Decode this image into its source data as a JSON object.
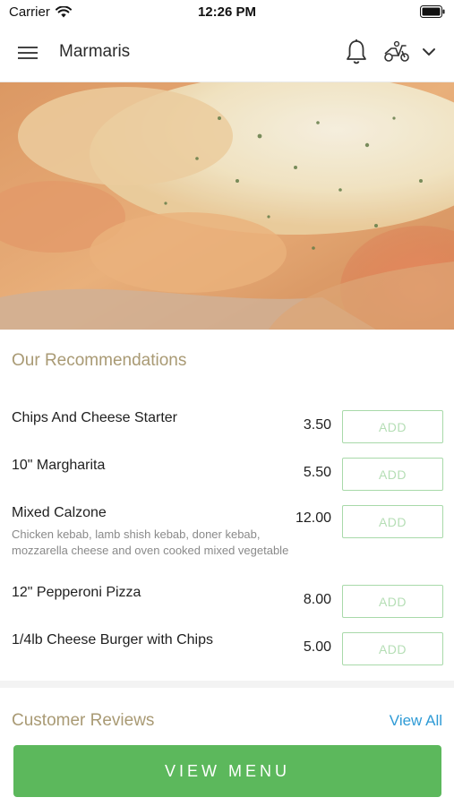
{
  "status_bar": {
    "carrier": "Carrier",
    "time": "12:26 PM"
  },
  "nav": {
    "title": "Marmaris",
    "icons": [
      "menu-icon",
      "bell-icon",
      "scooter-icon",
      "chevron-down-icon"
    ]
  },
  "recommendations": {
    "title": "Our Recommendations",
    "add_label": "ADD",
    "items": [
      {
        "name": "Chips And Cheese Starter",
        "price": "3.50",
        "description": ""
      },
      {
        "name": "10\" Margharita",
        "price": "5.50",
        "description": ""
      },
      {
        "name": "Mixed Calzone",
        "price": "12.00",
        "description": "Chicken kebab, lamb shish kebab, doner kebab, mozzarella cheese and oven cooked mixed vegetable"
      },
      {
        "name": "12\" Pepperoni Pizza",
        "price": "8.00",
        "description": ""
      },
      {
        "name": "1/4lb Cheese Burger with Chips",
        "price": "5.00",
        "description": ""
      }
    ]
  },
  "reviews": {
    "title": "Customer Reviews",
    "view_all": "View All"
  },
  "footer": {
    "view_menu": "VIEW MENU"
  },
  "colors": {
    "accent_green": "#5cb85c",
    "section_title": "#a99a74",
    "link_blue": "#2f9bd6"
  }
}
